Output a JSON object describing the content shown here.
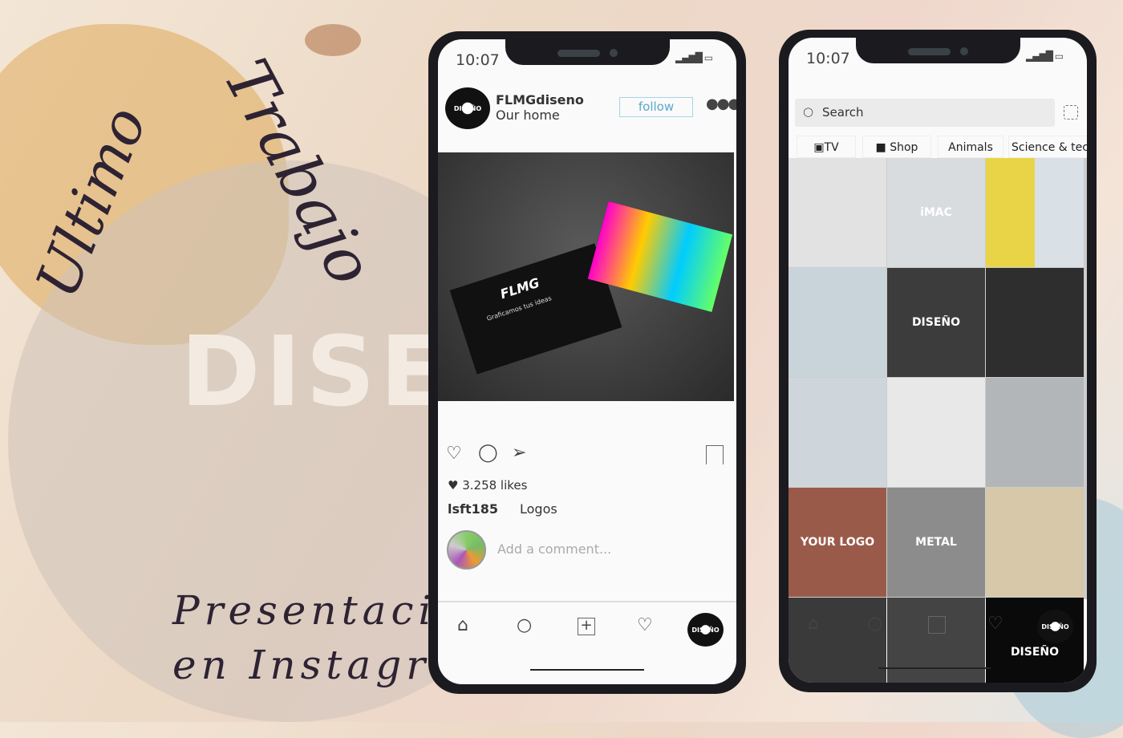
{
  "background": {
    "title_top": "Ultimo Trabajo",
    "title_top_word1": "Ultimo",
    "title_top_word2": "Trabajo",
    "faded_word": "DISE",
    "subtitle_line1": "Presentación",
    "subtitle_line2": "en Instagram"
  },
  "phone_post": {
    "status_time": "10:07",
    "profile": {
      "username": "FLMGdiseno",
      "subtitle": "Our home",
      "avatar_text": "DISEÑO"
    },
    "follow_label": "follow",
    "more_icon": "more-dots-icon",
    "post_image_caption": "Graficamos tus ideas",
    "post_image_brand": "FLMG",
    "likes": "3.258 likes",
    "caption_user": "lsft185",
    "caption_text": "Logos",
    "comment_placeholder": "Add a comment...",
    "nav": [
      "home-icon",
      "search-icon",
      "add-icon",
      "heart-icon",
      "profile-avatar"
    ]
  },
  "phone_explore": {
    "status_time": "10:07",
    "search_placeholder": "Search",
    "categories": [
      {
        "label": "TV",
        "icon": "tv-icon"
      },
      {
        "label": "Shop",
        "icon": "shopping-bag-icon"
      },
      {
        "label": "Animals"
      },
      {
        "label": "Science & tec"
      }
    ],
    "tiles": [
      {
        "color": "#e2e2e2",
        "text": ""
      },
      {
        "color": "#d9dcdf",
        "text": "iMAC"
      },
      {
        "color": "#e9d447",
        "text": ""
      },
      {
        "color": "#c9d3da",
        "text": ""
      },
      {
        "color": "#3c3c3c",
        "text": "DISEÑO"
      },
      {
        "color": "#2e2e2e",
        "text": ""
      },
      {
        "color": "#cfd6db",
        "text": ""
      },
      {
        "color": "#e8e8e8",
        "text": ""
      },
      {
        "color": "#b3b6b8",
        "text": ""
      },
      {
        "color": "#9a5a4a",
        "text": "YOUR LOGO"
      },
      {
        "color": "#8c8c8c",
        "text": "METAL"
      },
      {
        "color": "#d6c8a8",
        "text": ""
      },
      {
        "color": "#3a3a3a",
        "text": ""
      },
      {
        "color": "#444",
        "text": ""
      },
      {
        "color": "#0a0a0a",
        "text": "DISEÑO"
      }
    ],
    "nav": [
      "home-icon",
      "search-icon",
      "add-icon",
      "heart-icon",
      "profile-avatar"
    ]
  }
}
